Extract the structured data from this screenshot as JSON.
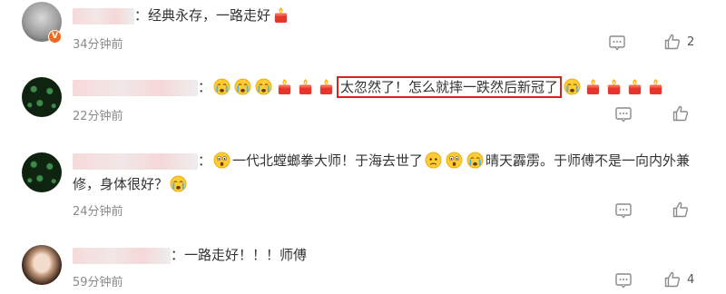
{
  "comments": [
    {
      "text_after": "：经典永存，一路走好",
      "time": "34分钟前",
      "likes": "2"
    },
    {
      "text_colon": "：",
      "highlight": "太忽然了！怎么就摔一跌然后新冠了",
      "time": "22分钟前",
      "likes": ""
    },
    {
      "text_colon": "：",
      "part1": "一代北螳螂拳大师！于海去世了",
      "part2": "晴天霹雳。于师傅不是一向内外兼",
      "line2": "修，身体很好？",
      "time": "24分钟前",
      "likes": ""
    },
    {
      "text_after": "：一路走好！！！师傅",
      "time": "59分钟前",
      "likes": "4"
    }
  ],
  "icons": [
    "comment-icon",
    "thumbs-up-icon",
    "candle-emoji",
    "crying-emoji",
    "shocked-emoji",
    "worried-emoji"
  ]
}
